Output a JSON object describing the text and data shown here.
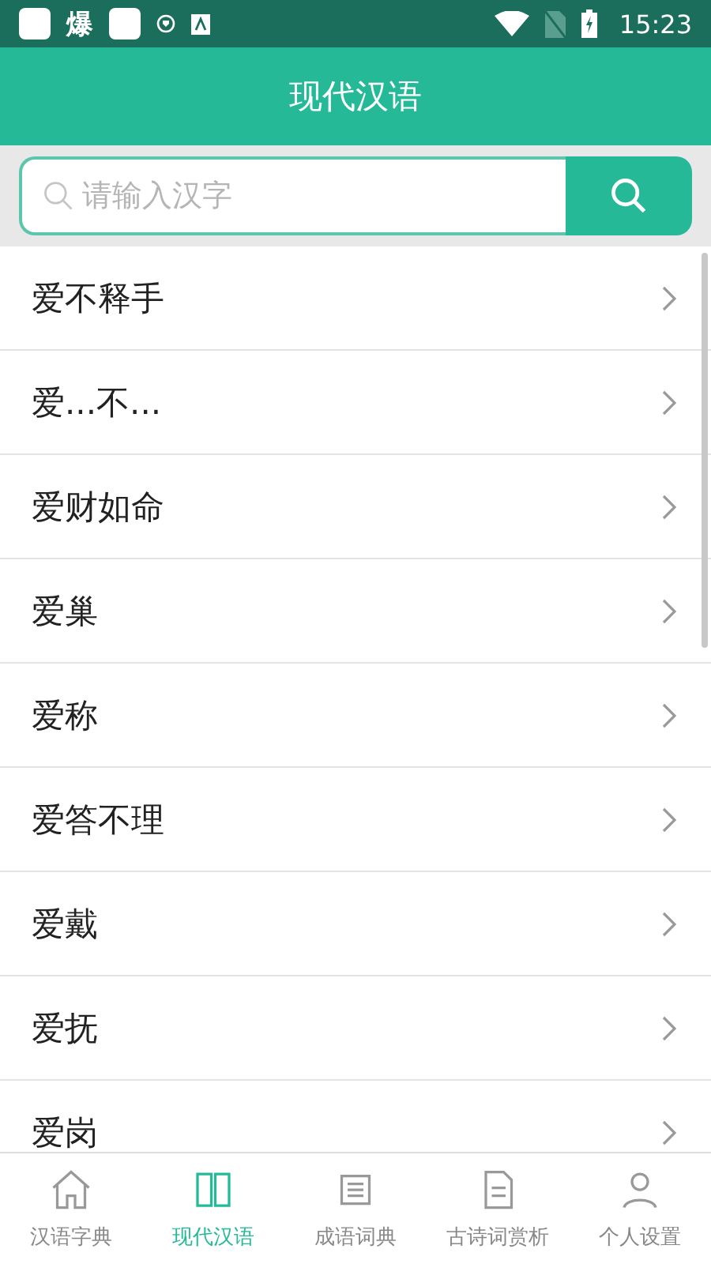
{
  "status_bar": {
    "time": "15:23",
    "notification_text": "爆"
  },
  "header": {
    "title": "现代汉语"
  },
  "search": {
    "placeholder": "请输入汉字"
  },
  "entries": [
    {
      "word": "爱不释手"
    },
    {
      "word": "爱...不..."
    },
    {
      "word": "爱财如命"
    },
    {
      "word": "爱巢"
    },
    {
      "word": "爱称"
    },
    {
      "word": "爱答不理"
    },
    {
      "word": "爱戴"
    },
    {
      "word": "爱抚"
    },
    {
      "word": "爱岗"
    }
  ],
  "tabs": [
    {
      "label": "汉语字典",
      "kind": "home",
      "selected": false
    },
    {
      "label": "现代汉语",
      "kind": "book",
      "selected": true
    },
    {
      "label": "成语词典",
      "kind": "list",
      "selected": false
    },
    {
      "label": "古诗词赏析",
      "kind": "scroll",
      "selected": false
    },
    {
      "label": "个人设置",
      "kind": "user",
      "selected": false
    }
  ]
}
